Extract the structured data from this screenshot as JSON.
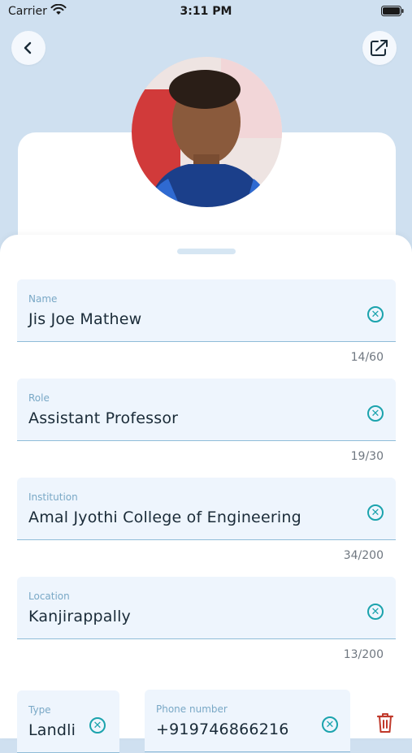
{
  "status": {
    "carrier": "Carrier",
    "time": "3:11 PM"
  },
  "profile": {
    "partial_text": ""
  },
  "fields": {
    "name": {
      "label": "Name",
      "value": "Jis Joe Mathew",
      "counter": "14/60"
    },
    "role": {
      "label": "Role",
      "value": "Assistant Professor",
      "counter": "19/30"
    },
    "institution": {
      "label": "Institution",
      "value": "Amal Jyothi College of Engineering",
      "counter": "34/200"
    },
    "location": {
      "label": "Location",
      "value": "Kanjirappally",
      "counter": "13/200"
    },
    "type": {
      "label": "Type",
      "value": "Landli"
    },
    "phone": {
      "label": "Phone number",
      "value": "+919746866216"
    }
  },
  "icons": {
    "back": "chevron-left-icon",
    "share": "share-export-icon",
    "clear": "close-circle-icon",
    "delete": "trash-icon"
  },
  "colors": {
    "accent": "#1ba3ad",
    "danger": "#c0392b",
    "field_bg": "#eef5fd",
    "background": "#cfe0f0"
  }
}
